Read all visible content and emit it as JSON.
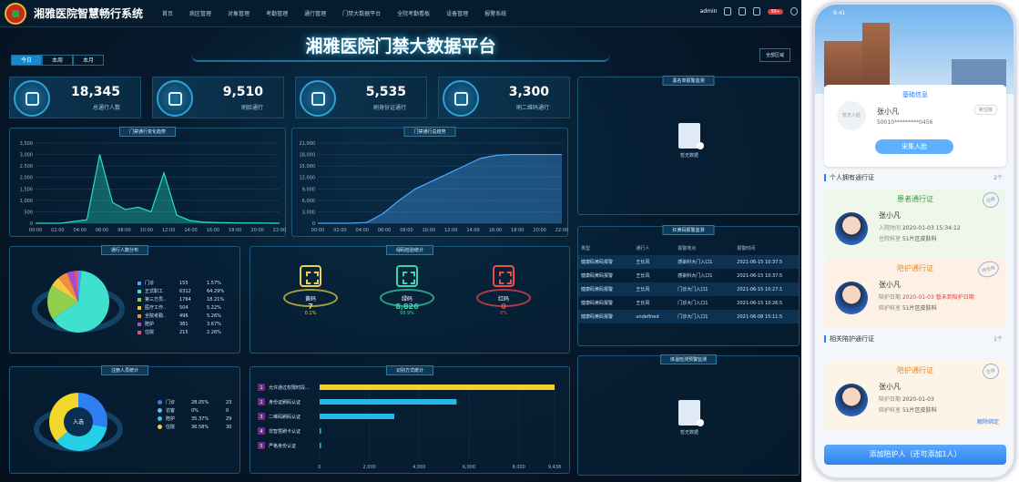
{
  "nav": {
    "system": "湘雅医院智慧畅行系统",
    "menu": [
      "首页",
      "病区管理",
      "对象管理",
      "考勤管理",
      "通行管理",
      "门禁大数据平台",
      "全院考勤看板",
      "设备管理",
      "报警系统"
    ],
    "user": "admin",
    "badge": "99+"
  },
  "title": "湘雅医院门禁大数据平台",
  "area": "全部区域",
  "tabs": [
    "今日",
    "本周",
    "本月"
  ],
  "stats": [
    {
      "value": "18,345",
      "label": "总通行人数",
      "icon": "people-icon"
    },
    {
      "value": "9,510",
      "label": "刷脸通行",
      "icon": "face-icon"
    },
    {
      "value": "5,535",
      "label": "刷身份证通行",
      "icon": "id-card-icon"
    },
    {
      "value": "3,300",
      "label": "刷二维码通行",
      "icon": "qrcode-icon"
    }
  ],
  "panels": {
    "trend": "门禁通行变化趋势",
    "total": "门禁通行总趋势",
    "dist": "通行人数分布",
    "check": "绿码检验统计",
    "reg": "注册人员统计",
    "method": "识别方式统计",
    "blacklist": "黑名单报警监测",
    "redcode": "红黄码报警监测",
    "temp": "体温检测预警监测",
    "nodata": "暂无数据"
  },
  "chart_data": [
    {
      "type": "area",
      "title": "门禁通行变化趋势",
      "x": [
        "00:00",
        "02:00",
        "04:00",
        "06:00",
        "08:00",
        "10:00",
        "12:00",
        "14:00",
        "16:00",
        "18:00",
        "20:00",
        "22:00"
      ],
      "yticks": [
        "0",
        "500",
        "1,000",
        "1,500",
        "2,000",
        "2,500",
        "3,000",
        "3,500"
      ],
      "ylim": [
        0,
        3500
      ],
      "values": [
        0,
        0,
        0,
        80,
        150,
        3000,
        900,
        600,
        700,
        500,
        2200,
        350,
        120,
        50,
        30,
        20,
        10,
        10,
        5,
        0
      ]
    },
    {
      "type": "area",
      "title": "门禁通行总趋势",
      "x": [
        "00:00",
        "02:00",
        "04:00",
        "06:00",
        "08:00",
        "10:00",
        "12:00",
        "14:00",
        "16:00",
        "18:00",
        "20:00",
        "22:00"
      ],
      "yticks": [
        "0",
        "3,000",
        "6,000",
        "9,000",
        "12,000",
        "15,000",
        "18,000",
        "21,000"
      ],
      "ylim": [
        0,
        21000
      ],
      "values": [
        0,
        0,
        0,
        200,
        2500,
        6000,
        9000,
        11000,
        13000,
        15000,
        17000,
        17800,
        18000,
        18000,
        18000,
        18000
      ]
    },
    {
      "type": "pie",
      "title": "通行人数分布",
      "legend": [
        {
          "name": "门诊",
          "count": "155",
          "pct": "1.57%",
          "color": "#3fa0ff"
        },
        {
          "name": "正式职工",
          "count": "6312",
          "pct": "64.29%",
          "color": "#3fe0d0"
        },
        {
          "name": "第三方员..",
          "count": "1764",
          "pct": "18.21%",
          "color": "#8fd14f"
        },
        {
          "name": "医疗工作..",
          "count": "504",
          "pct": "5.22%",
          "color": "#f5c93c"
        },
        {
          "name": "全院考勤..",
          "count": "496",
          "pct": "5.26%",
          "color": "#f08c3c"
        },
        {
          "name": "陪护",
          "count": "381",
          "pct": "3.67%",
          "color": "#a64bd4"
        },
        {
          "name": "住院",
          "count": "215",
          "pct": "2.26%",
          "color": "#e84f7a"
        }
      ]
    },
    {
      "type": "bar",
      "title": "绿码检验统计",
      "items": [
        {
          "name": "黄码",
          "value": "7",
          "pct": "0.1%",
          "color": "#e8d44a"
        },
        {
          "name": "绿码",
          "value": "8,826",
          "pct": "99.9%",
          "color": "#3ad7a8"
        },
        {
          "name": "红码",
          "value": "0",
          "pct": "0%",
          "color": "#f24b4b"
        }
      ]
    },
    {
      "type": "pie",
      "title": "注册人员统计",
      "center": "入选",
      "legend": [
        {
          "name": "门诊",
          "pct": "28.05%",
          "count": "23",
          "color": "#2e7ff0"
        },
        {
          "name": "访客",
          "pct": "0%",
          "count": "0",
          "color": "#6fb3ff"
        },
        {
          "name": "陪护",
          "pct": "35.37%",
          "count": "29",
          "color": "#24d0e8"
        },
        {
          "name": "住院",
          "pct": "36.58%",
          "count": "30",
          "color": "#f3d62a"
        }
      ]
    },
    {
      "type": "bar",
      "title": "识别方式统计",
      "categories": [
        "允许通过权限时段...",
        "身份证刷码认证",
        "二维码刷码认证",
        "非智慧刷卡认证",
        "严格身份认证"
      ],
      "values": [
        9438,
        5500,
        3000,
        0,
        0
      ],
      "xticks": [
        "0",
        "2,000",
        "4,000",
        "6,000",
        "8,000",
        "9,438"
      ],
      "xlim": [
        0,
        9438
      ]
    }
  ],
  "redcode": {
    "headers": [
      "类型",
      "通行人",
      "报警地点",
      "报警时间"
    ],
    "rows": [
      [
        "健康码黄码报警",
        "王长风",
        "感染科大门入口1",
        "2021-06-15 10:37:5"
      ],
      [
        "健康码黄码报警",
        "王长风",
        "感染科大门入口1",
        "2021-06-15 10:37:5"
      ],
      [
        "健康码黄码报警",
        "王长风",
        "门诊大门入口1",
        "2021-06-15 10:27:1"
      ],
      [
        "健康码黄码报警",
        "王长风",
        "门诊大门入口1",
        "2021-06-15 10:26:5"
      ],
      [
        "健康码黄码报警",
        "undefined",
        "门诊大门入口1",
        "2021-06-08 15:11:5"
      ]
    ]
  },
  "phone": {
    "time": "9:41",
    "basic": "基础信息",
    "name": "张小凡",
    "id": "50010*********0456",
    "noface": "暂无人脸",
    "tag": "新住院",
    "collect": "采集人脸",
    "own": "个人拥有通行证",
    "own_count": "2个",
    "related": "相关陪护通行证",
    "related_count": "1个",
    "passes": [
      {
        "title": "患者通行证",
        "name": "张小凡",
        "l1k": "入院时间",
        "l1v": "2020-01-03 15:34:12",
        "l2k": "住院科室",
        "l2v": "51片区皮肤科",
        "stamp": "住院",
        "color": "#3b9b46",
        "bg": "#eef7ea"
      },
      {
        "title": "陪护通行证",
        "name": "张小凡",
        "l1k": "陪护日期",
        "l1v": "2020-01-03 暂未到陪护日期",
        "l2k": "陪护科室",
        "l2v": "51片区皮肤科",
        "stamp": "待生效",
        "color": "#e78a2b",
        "bg": "#fdf1e5"
      },
      {
        "title": "陪护通行证",
        "name": "张小凡",
        "l1k": "陪护日期",
        "l1v": "2020-01-03",
        "l2k": "陪护科室",
        "l2v": "51片区皮肤科",
        "stamp": "生效",
        "color": "#e78a2b",
        "bg": "#fdf4e8",
        "unbind": "解除绑定"
      }
    ],
    "add": "添加陪护人（还可添加1人）"
  }
}
